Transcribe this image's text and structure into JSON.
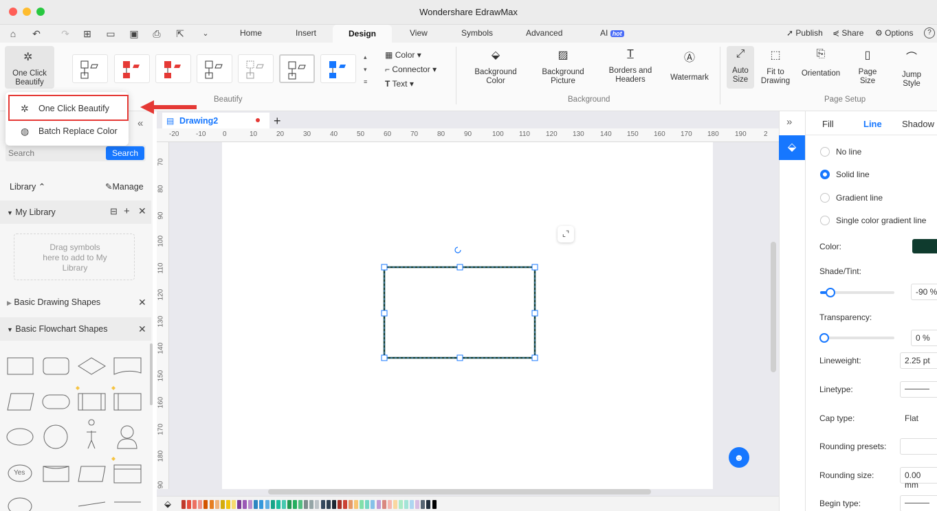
{
  "window": {
    "title": "Wondershare EdrawMax"
  },
  "menu": {
    "tabs": [
      "Home",
      "Insert",
      "Design",
      "View",
      "Symbols",
      "Advanced",
      "AI"
    ],
    "ai_badge": "hot",
    "right_actions": {
      "publish": "Publish",
      "share": "Share",
      "options": "Options"
    }
  },
  "ribbon": {
    "one_click_beautify": "One Click Beautify",
    "format": {
      "color": "Color",
      "connector": "Connector",
      "text": "Text"
    },
    "background": {
      "background_color": "Background Color",
      "background_picture": "Background Picture",
      "borders_headers": "Borders and Headers",
      "watermark": "Watermark"
    },
    "page_setup": {
      "auto_size": "Auto Size",
      "fit_to_drawing": "Fit to Drawing",
      "orientation": "Orientation",
      "page_size": "Page Size",
      "jump_style": "Jump Style"
    },
    "groups": {
      "beautify": "Beautify",
      "background": "Background",
      "page_setup": "Page Setup"
    }
  },
  "dropdown": {
    "item1": "One Click Beautify",
    "item2": "Batch Replace Color"
  },
  "left_panel": {
    "search_placeholder": "Search",
    "search_button": "Search",
    "library": "Library",
    "manage": "Manage",
    "my_library": "My Library",
    "drop_hint": "Drag symbols here to add to My Library",
    "basic_drawing": "Basic Drawing Shapes",
    "basic_flowchart": "Basic Flowchart Shapes",
    "yes_shape": "Yes"
  },
  "document": {
    "tab": "Drawing2"
  },
  "rulers": {
    "h": [
      "-20",
      "-10",
      "0",
      "10",
      "20",
      "30",
      "40",
      "50",
      "60",
      "70",
      "80",
      "90",
      "100",
      "110",
      "120",
      "130",
      "140",
      "150",
      "160",
      "170",
      "180",
      "190",
      "2"
    ],
    "v": [
      "70",
      "80",
      "90",
      "100",
      "110",
      "120",
      "130",
      "140",
      "150",
      "160",
      "170",
      "180",
      "90"
    ]
  },
  "right_panel": {
    "tabs": {
      "fill": "Fill",
      "line": "Line",
      "shadow": "Shadow"
    },
    "options": {
      "no_line": "No line",
      "solid_line": "Solid line",
      "gradient_line": "Gradient line",
      "single_color_gradient": "Single color gradient line"
    },
    "labels": {
      "color": "Color:",
      "shade_tint": "Shade/Tint:",
      "transparency": "Transparency:",
      "lineweight": "Lineweight:",
      "linetype": "Linetype:",
      "cap_type": "Cap type:",
      "rounding_presets": "Rounding presets:",
      "rounding_size": "Rounding size:",
      "begin_type": "Begin type:"
    },
    "values": {
      "shade_tint": "-90 %",
      "transparency": "0 %",
      "lineweight": "2.25 pt",
      "cap_type": "Flat",
      "rounding_size": "0.00 mm"
    },
    "shade_tint_level": 0.08,
    "transparency_level": 0.0
  },
  "colors": {
    "accent": "#1677ff",
    "highlight": "#e53935",
    "line_color": "#0f3b2e"
  },
  "palette": [
    "#c0392b",
    "#e74c3c",
    "#ec7063",
    "#f1948a",
    "#d35400",
    "#e67e22",
    "#f0b27a",
    "#d4ac0d",
    "#f1c40f",
    "#f7dc6f",
    "#7d3c98",
    "#9b59b6",
    "#bb8fce",
    "#2e86c1",
    "#3498db",
    "#5dade2",
    "#17a589",
    "#1abc9c",
    "#48c9b0",
    "#229954",
    "#27ae60",
    "#52be80",
    "#7f8c8d",
    "#95a5a6",
    "#bdc3c7",
    "#34495e",
    "#2c3e50",
    "#1c2833",
    "#a93226",
    "#cb4335",
    "#e59866",
    "#f8c471",
    "#82e0aa",
    "#76d7c4",
    "#85c1e9",
    "#c39bd3",
    "#d98880",
    "#f5b7b1",
    "#fad7a0",
    "#abebc6",
    "#a3e4d7",
    "#aed6f1",
    "#d7bde2",
    "#566573",
    "#212f3d",
    "#000000"
  ]
}
